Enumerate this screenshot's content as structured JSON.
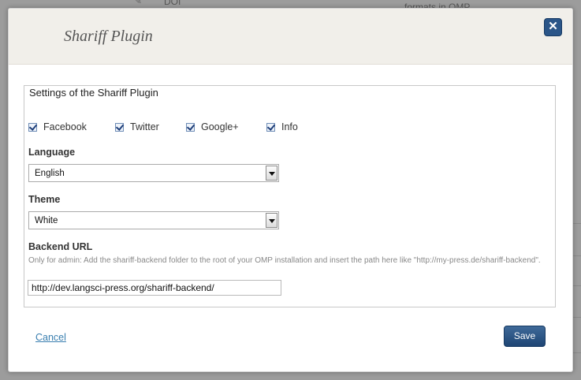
{
  "background": {
    "text_top_left": "DOI",
    "text_top_right": "formats in OMP"
  },
  "modal": {
    "title": "Shariff Plugin",
    "close_glyph": "✕",
    "fieldset_legend": "Settings of the Shariff Plugin",
    "services": [
      {
        "label": "Facebook",
        "checked": true
      },
      {
        "label": "Twitter",
        "checked": true
      },
      {
        "label": "Google+",
        "checked": true
      },
      {
        "label": "Info",
        "checked": true
      }
    ],
    "language": {
      "label": "Language",
      "selected": "English"
    },
    "theme": {
      "label": "Theme",
      "selected": "White"
    },
    "backend_url": {
      "label": "Backend URL",
      "help": "Only for admin: Add the shariff-backend folder to the root of your OMP installation and insert the path here like \"http://my-press.de/shariff-backend\".",
      "value": "http://dev.langsci-press.org/shariff-backend/"
    },
    "cancel_label": "Cancel",
    "save_label": "Save"
  },
  "colors": {
    "accent": "#2a5588",
    "header_bg": "#f1efea",
    "link": "#3a7fb0"
  },
  "icons": {
    "close": "close-icon",
    "checkbox": "checkmark-icon",
    "dropdown": "chevron-down-icon",
    "background_edit": "pencil-icon"
  }
}
